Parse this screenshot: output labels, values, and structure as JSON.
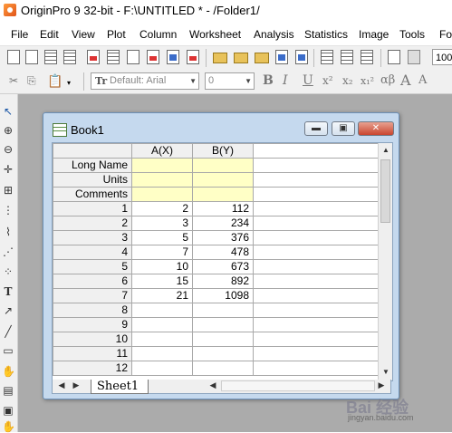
{
  "window": {
    "title": "OriginPro 9 32-bit - F:\\UNTITLED * - /Folder1/"
  },
  "menu": {
    "items": [
      "File",
      "Edit",
      "View",
      "Plot",
      "Column",
      "Worksheet",
      "Analysis",
      "Statistics",
      "Image",
      "Tools",
      "Fo"
    ]
  },
  "toolbar": {
    "zoom": "100",
    "font_name": "Default: Arial",
    "font_size": "0",
    "format_buttons": [
      "B",
      "I",
      "U",
      "x²",
      "x₂",
      "x₁²",
      "αβ",
      "A",
      "A"
    ]
  },
  "book": {
    "title": "Book1",
    "columns": [
      "A(X)",
      "B(Y)"
    ],
    "meta_rows": [
      "Long Name",
      "Units",
      "Comments"
    ],
    "rows": [
      {
        "n": "1",
        "a": "2",
        "b": "112"
      },
      {
        "n": "2",
        "a": "3",
        "b": "234"
      },
      {
        "n": "3",
        "a": "5",
        "b": "376"
      },
      {
        "n": "4",
        "a": "7",
        "b": "478"
      },
      {
        "n": "5",
        "a": "10",
        "b": "673"
      },
      {
        "n": "6",
        "a": "15",
        "b": "892"
      },
      {
        "n": "7",
        "a": "21",
        "b": "1098"
      },
      {
        "n": "8",
        "a": "",
        "b": ""
      },
      {
        "n": "9",
        "a": "",
        "b": ""
      },
      {
        "n": "10",
        "a": "",
        "b": ""
      },
      {
        "n": "11",
        "a": "",
        "b": ""
      },
      {
        "n": "12",
        "a": "",
        "b": ""
      }
    ],
    "sheet_tab": "Sheet1"
  },
  "watermark": {
    "logo": "Bai 经验",
    "text": "jingyan.baidu.com"
  }
}
